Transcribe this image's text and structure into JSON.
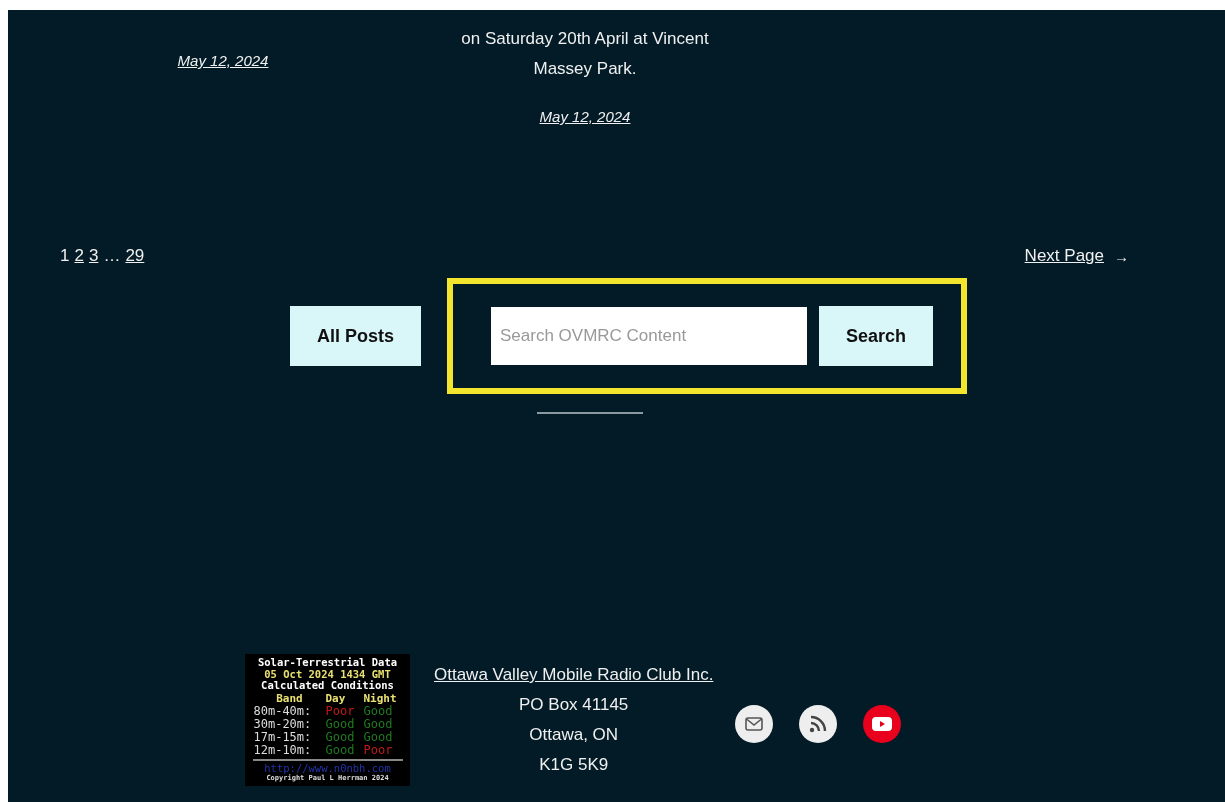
{
  "posts": [
    {
      "date": "May 12, 2024"
    },
    {
      "lines": [
        "on Saturday 20th April at Vincent",
        "Massey Park."
      ],
      "date": "May 12, 2024"
    }
  ],
  "pagination": {
    "pages": [
      {
        "label": "1",
        "selected": true
      },
      {
        "label": "2",
        "selected": false
      },
      {
        "label": "3",
        "selected": false
      },
      {
        "label": "29",
        "selected": false
      }
    ],
    "ellipsis": "…",
    "next": "Next Page",
    "next_arrow": "→"
  },
  "all_posts_button": "All Posts",
  "search": {
    "placeholder": "Search OVMRC Content",
    "button": "Search"
  },
  "solar_widget": {
    "title": "Solar-Terrestrial Data",
    "timestamp": "05 Oct 2024 1434 GMT",
    "subtitle": "Calculated Conditions",
    "headers": [
      "Band",
      "Day",
      "Night"
    ],
    "rows": [
      {
        "band": "80m-40m:",
        "day": {
          "text": "Poor",
          "kind": "poor"
        },
        "night": {
          "text": "Good",
          "kind": "good"
        }
      },
      {
        "band": "30m-20m:",
        "day": {
          "text": "Good",
          "kind": "good"
        },
        "night": {
          "text": "Good",
          "kind": "good"
        }
      },
      {
        "band": "17m-15m:",
        "day": {
          "text": "Good",
          "kind": "good"
        },
        "night": {
          "text": "Good",
          "kind": "good"
        }
      },
      {
        "band": "12m-10m:",
        "day": {
          "text": "Good",
          "kind": "good"
        },
        "night": {
          "text": "Poor",
          "kind": "poor"
        }
      }
    ],
    "url": "http://www.n0nbh.com",
    "copyright": "Copyright Paul L Herrman 2024"
  },
  "footer": {
    "club_link": "Ottawa Valley Mobile Radio Club Inc.",
    "address": [
      "PO Box 41145",
      "Ottawa, ON",
      "K1G 5K9"
    ],
    "social": [
      {
        "kind": "mail"
      },
      {
        "kind": "rss"
      },
      {
        "kind": "youtube"
      }
    ]
  }
}
